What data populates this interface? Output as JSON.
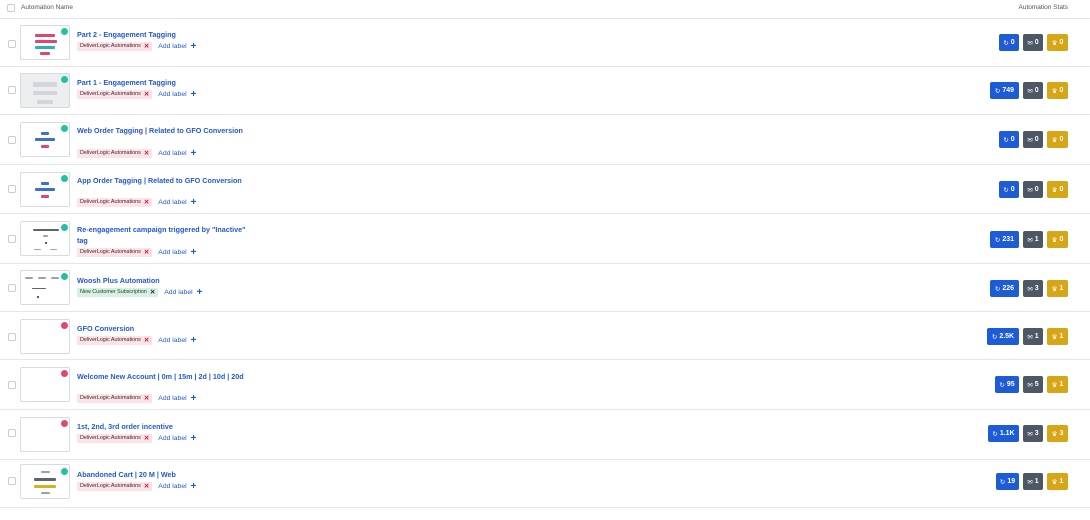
{
  "header": {
    "name_col": "Automation Name",
    "stats_col": "Automation Stats"
  },
  "colors": {
    "link": "#2457d6",
    "contacts_badge": "#1d5cd6",
    "emails_badge": "#4d5765",
    "goals_badge": "#d6a616",
    "active_dot": "#22c1a3",
    "inactive_dot": "#e0476b"
  },
  "icons": {
    "contacts": "refresh-icon",
    "emails": "envelope-icon",
    "goals": "trophy-icon",
    "remove": "close-icon",
    "add": "plus-icon"
  },
  "add_label_text": "Add label",
  "rows": [
    {
      "title": "Part 2 - Engagement Tagging",
      "label": "DeliverLogic Automations",
      "status": "active",
      "contacts": "0",
      "emails": "0",
      "goals": "0"
    },
    {
      "title": "Part 1 - Engagement Tagging",
      "label": "DeliverLogic Automations",
      "status": "active",
      "contacts": "749",
      "emails": "0",
      "goals": "0"
    },
    {
      "title": "Web Order Tagging | Related to GFO Conversion",
      "label": "DeliverLogic Automations",
      "status": "active",
      "contacts": "0",
      "emails": "0",
      "goals": "0"
    },
    {
      "title": "App Order Tagging | Related to GFO Conversion",
      "label": "DeliverLogic Automations",
      "status": "active",
      "contacts": "0",
      "emails": "0",
      "goals": "0"
    },
    {
      "title": "Re-engagement campaign triggered by \"Inactive\" tag",
      "label": "DeliverLogic Automations",
      "status": "active",
      "contacts": "231",
      "emails": "1",
      "goals": "0"
    },
    {
      "title": "Woosh Plus Automation",
      "label": "New Customer Subscription",
      "status": "active",
      "contacts": "226",
      "emails": "3",
      "goals": "1"
    },
    {
      "title": "GFO Conversion",
      "label": "DeliverLogic Automations",
      "status": "inactive",
      "contacts": "2.5K",
      "emails": "1",
      "goals": "1"
    },
    {
      "title": "Welcome New Account | 0m | 15m | 2d | 10d | 20d",
      "label": "DeliverLogic Automations",
      "status": "inactive",
      "contacts": "95",
      "emails": "5",
      "goals": "1"
    },
    {
      "title": "1st, 2nd, 3rd order incentive",
      "label": "DeliverLogic Automations",
      "status": "inactive",
      "contacts": "1.1K",
      "emails": "3",
      "goals": "3"
    },
    {
      "title": "Abandoned Cart | 20 M | Web",
      "label": "DeliverLogic Automations",
      "status": "active",
      "contacts": "19",
      "emails": "1",
      "goals": "1"
    }
  ]
}
